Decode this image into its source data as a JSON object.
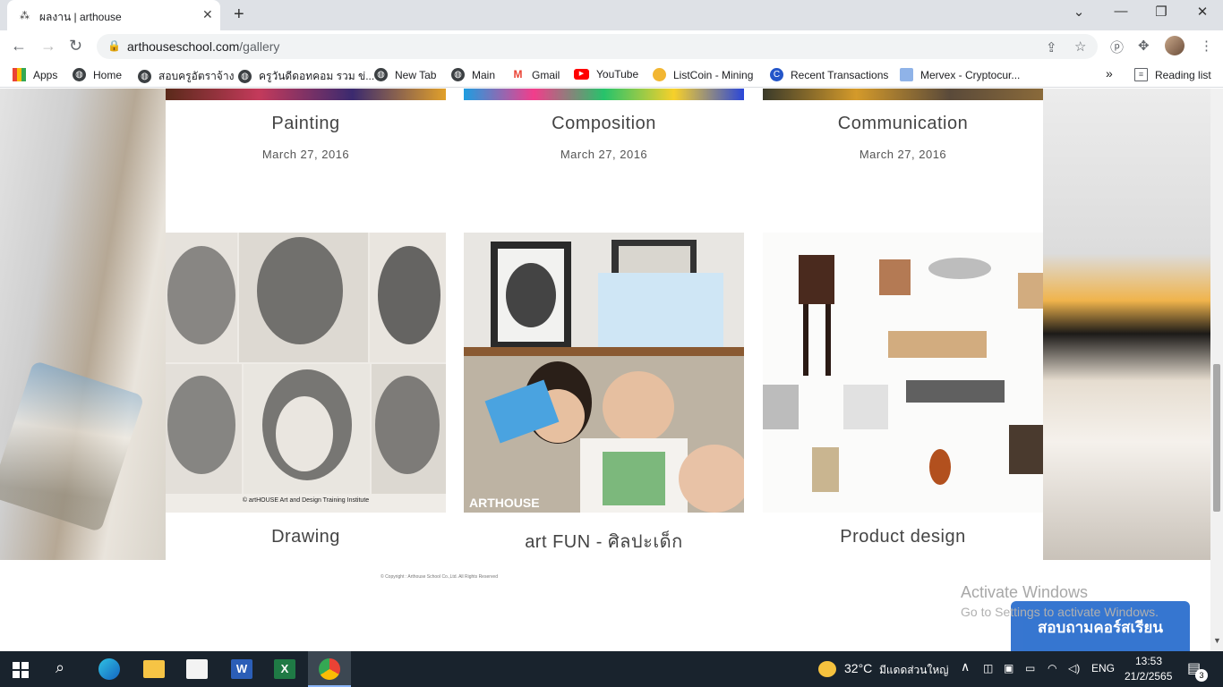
{
  "browser": {
    "tab_title": "ผลงาน | arthouse",
    "url_domain": "arthouseschool.com",
    "url_path": "/gallery",
    "bookmarks": [
      {
        "label": "Apps",
        "icon": "apps-grid-icon"
      },
      {
        "label": "Home",
        "icon": "globe-icon"
      },
      {
        "label": "สอบครูอัตราจ้าง",
        "icon": "globe-icon"
      },
      {
        "label": "ครูวันดีดอทคอม รวม ข่...",
        "icon": "globe-icon"
      },
      {
        "label": "New Tab",
        "icon": "globe-icon"
      },
      {
        "label": "Main",
        "icon": "globe-icon"
      },
      {
        "label": "Gmail",
        "icon": "gmail-icon"
      },
      {
        "label": "YouTube",
        "icon": "youtube-icon"
      },
      {
        "label": "ListCoin - Mining",
        "icon": "listcoin-icon"
      },
      {
        "label": "Recent Transactions",
        "icon": "coin-icon"
      },
      {
        "label": "Mervex - Cryptocur...",
        "icon": "mervex-icon"
      }
    ],
    "reading_list": "Reading list",
    "more_bookmarks": "»"
  },
  "gallery": {
    "top_row": [
      {
        "title": "Painting",
        "date": "March 27, 2016"
      },
      {
        "title": "Composition",
        "date": "March 27, 2016"
      },
      {
        "title": "Communication",
        "date": "March 27, 2016"
      }
    ],
    "bottom_row": [
      {
        "title": "Drawing",
        "caption": "© artHOUSE Art and Design Training Institute"
      },
      {
        "title": "art FUN - ศิลปะเด็ก",
        "caption": "ARTHOUSE"
      },
      {
        "title": "Product design"
      }
    ],
    "copyright": "© Copyright : Arthouse School Co.,Ltd. All Rights Reserved"
  },
  "overlay": {
    "activate_title": "Activate Windows",
    "activate_sub": "Go to Settings to activate Windows.",
    "chat_button": "สอบถามคอร์สเรียน"
  },
  "taskbar": {
    "weather_temp": "32°C",
    "weather_desc": "มีแดดส่วนใหญ่",
    "language": "ENG",
    "time": "13:53",
    "date": "21/2/2565",
    "notification_count": "3"
  },
  "colors": {
    "chat_button": "#2c6fce",
    "taskbar": "#19232d"
  }
}
